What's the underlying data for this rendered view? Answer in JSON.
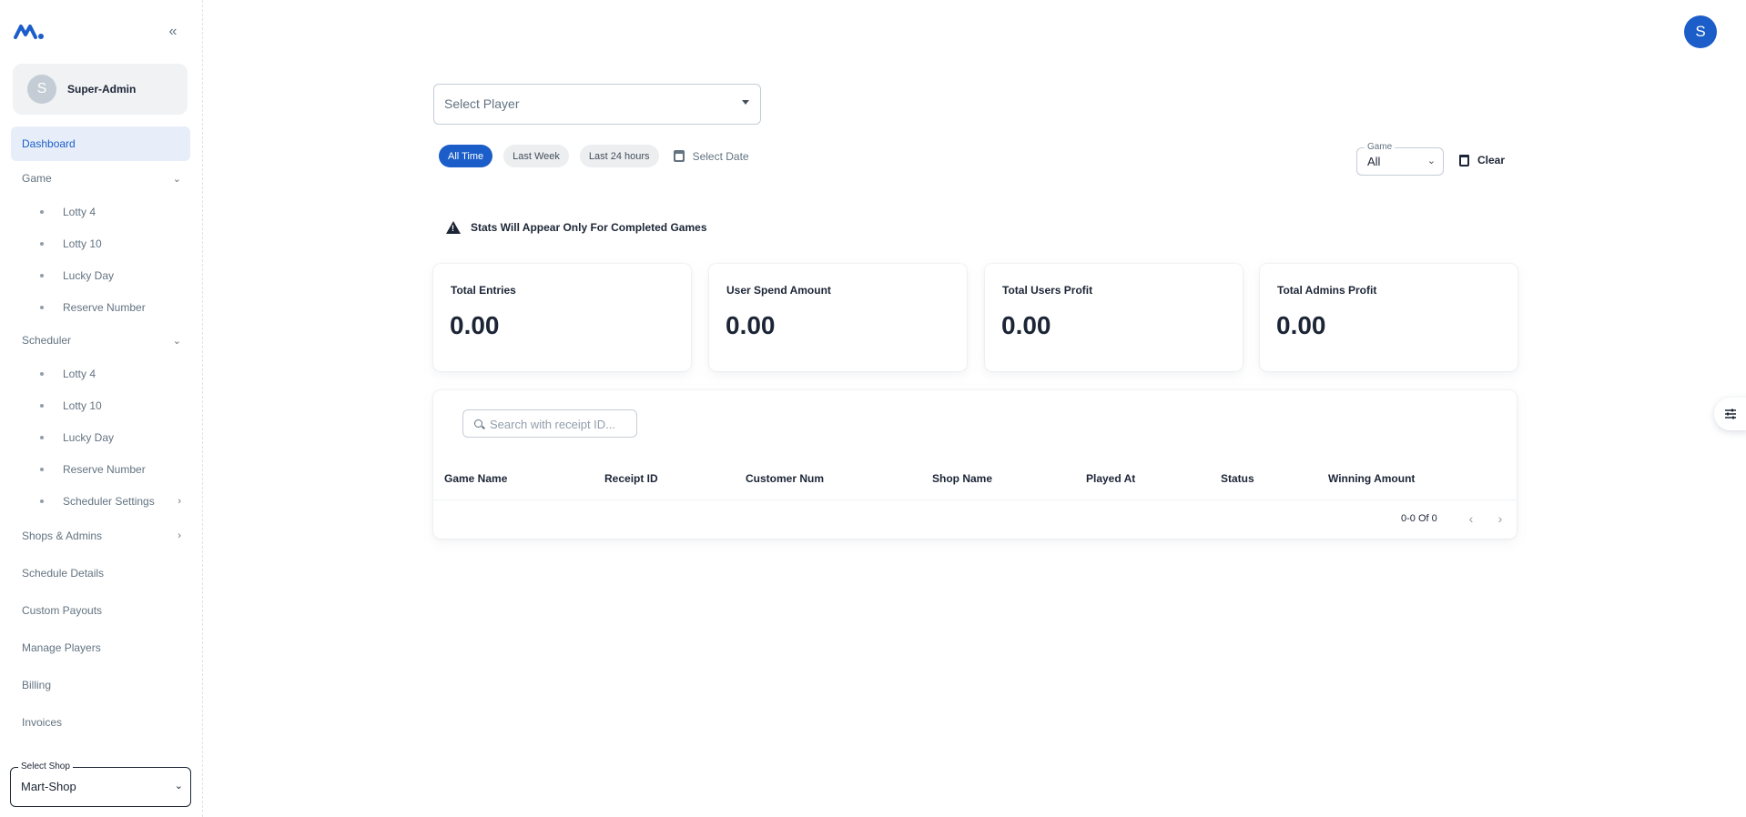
{
  "sidebar": {
    "user_initial": "S",
    "user_name": "Super-Admin",
    "nav": {
      "dashboard": "Dashboard",
      "game": "Game",
      "game_items": [
        "Lotty 4",
        "Lotty 10",
        "Lucky Day",
        "Reserve Number"
      ],
      "scheduler": "Scheduler",
      "scheduler_items": [
        "Lotty 4",
        "Lotty 10",
        "Lucky Day",
        "Reserve Number",
        "Scheduler Settings"
      ],
      "shops_admins": "Shops & Admins",
      "schedule_details": "Schedule Details",
      "custom_payouts": "Custom Payouts",
      "manage_players": "Manage Players",
      "billing": "Billing",
      "invoices": "Invoices"
    },
    "shop_select": {
      "label": "Select Shop",
      "value": "Mart-Shop"
    }
  },
  "header": {
    "avatar_initial": "S"
  },
  "filters": {
    "player_placeholder": "Select Player",
    "chips": [
      "All Time",
      "Last Week",
      "Last 24 hours"
    ],
    "active_chip": "All Time",
    "select_date": "Select Date",
    "game_label": "Game",
    "game_value": "All",
    "clear": "Clear"
  },
  "notice": "Stats Will Appear Only For Completed Games",
  "stats": [
    {
      "label": "Total Entries",
      "value": "0.00"
    },
    {
      "label": "User Spend Amount",
      "value": "0.00"
    },
    {
      "label": "Total Users Profit",
      "value": "0.00"
    },
    {
      "label": "Total Admins Profit",
      "value": "0.00"
    }
  ],
  "table": {
    "search_placeholder": "Search with receipt ID...",
    "columns": [
      "Game Name",
      "Receipt ID",
      "Customer Num",
      "Shop Name",
      "Played At",
      "Status",
      "Winning Amount"
    ],
    "rows": [],
    "pagination": "0-0 Of 0"
  },
  "colors": {
    "primary": "#1b5ec9",
    "active_nav_bg": "#e8eef9",
    "text": "#1c2536",
    "muted": "#637381"
  }
}
